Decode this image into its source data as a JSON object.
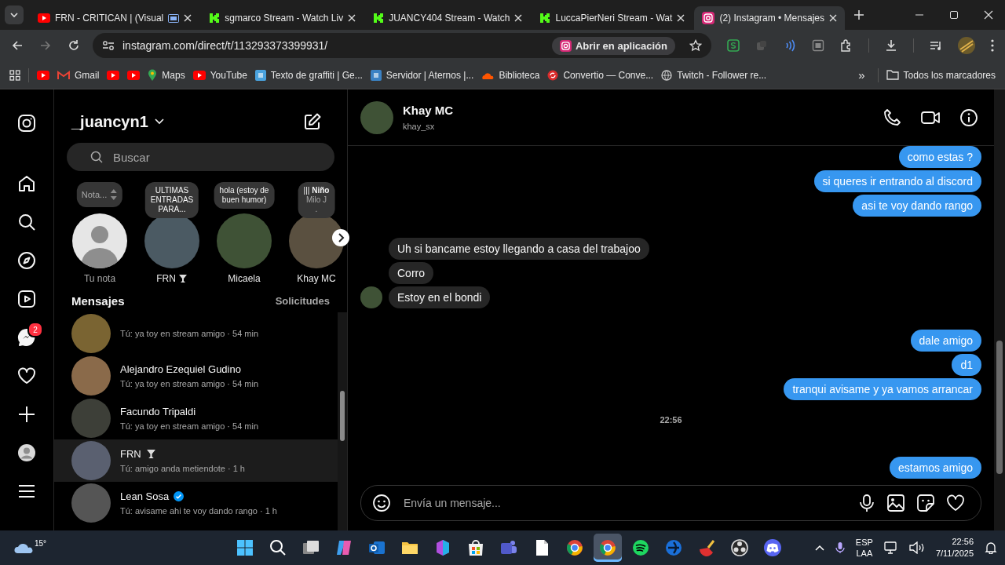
{
  "browser": {
    "tabs": [
      {
        "title": "FRN - CRITICAN | (Visual",
        "kind": "youtube",
        "casting": true,
        "selected": false
      },
      {
        "title": "sgmarco Stream - Watch Liv",
        "kind": "kick",
        "casting": false,
        "selected": false
      },
      {
        "title": "JUANCY404 Stream - Watch",
        "kind": "kick",
        "casting": false,
        "selected": false
      },
      {
        "title": "LuccaPierNeri Stream - Wat",
        "kind": "kick",
        "casting": false,
        "selected": false
      },
      {
        "title": "(2) Instagram • Mensajes",
        "kind": "instagram",
        "casting": false,
        "selected": true
      }
    ],
    "url": "instagram.com/direct/t/113293373399931/",
    "open_app": "Abrir en aplicación",
    "bookmarks": [
      {
        "kind": "youtube"
      },
      {
        "kind": "gmail",
        "label": "Gmail"
      },
      {
        "kind": "youtube"
      },
      {
        "kind": "youtube"
      },
      {
        "kind": "maps",
        "label": "Maps"
      },
      {
        "kind": "youtube",
        "label": "YouTube"
      },
      {
        "kind": "graffiti",
        "label": "Texto de graffiti | Ge..."
      },
      {
        "kind": "aternos",
        "label": "Servidor | Aternos |..."
      },
      {
        "kind": "cloud",
        "label": "Biblioteca"
      },
      {
        "kind": "convertio",
        "label": "Convertio — Conve..."
      },
      {
        "kind": "globe",
        "label": "Twitch - Follower re..."
      }
    ],
    "more_bookmarks": "»",
    "all_bookmarks": "Todos los marcadores"
  },
  "instagram": {
    "rail": [
      {
        "kind": "logo"
      },
      {
        "kind": "home"
      },
      {
        "kind": "search"
      },
      {
        "kind": "explore"
      },
      {
        "kind": "reels"
      },
      {
        "kind": "messages",
        "badge": "2"
      },
      {
        "kind": "notifications"
      },
      {
        "kind": "create"
      },
      {
        "kind": "profile"
      },
      {
        "kind": "more"
      }
    ],
    "account": "_juancyn1",
    "search": {
      "placeholder": "Buscar"
    },
    "notes": [
      {
        "kind": "self",
        "bubble": [
          "Nota..."
        ],
        "name": "Tu nota",
        "trophy": false
      },
      {
        "kind": "friend",
        "bubble": [
          "ULTIMAS",
          "ENTRADAS",
          "PARA..."
        ],
        "name": "FRN",
        "trophy": true
      },
      {
        "kind": "friend",
        "bubble": [
          "hola (estoy de",
          "buen humor)"
        ],
        "name": "Micaela",
        "trophy": false
      },
      {
        "kind": "music",
        "bubble": [
          "||| **Niño**",
          "Milo J",
          "."
        ],
        "name": "Khay MC",
        "trophy": false
      }
    ],
    "messages_title": "Mensajes",
    "requests": "Solicitudes",
    "conversations": [
      {
        "preview": "Tú: ya toy en stream amigo · 54 min",
        "trophy": false,
        "verified": false,
        "selected": false
      },
      {
        "name": "Alejandro Ezequiel Gudino",
        "preview": "Tú: ya toy en stream amigo · 54 min",
        "trophy": false,
        "verified": false,
        "selected": false
      },
      {
        "name": "Facundo Tripaldi",
        "preview": "Tú: ya toy en stream amigo · 54 min",
        "trophy": false,
        "verified": false,
        "selected": false
      },
      {
        "name": "FRN",
        "preview": "Tú: amigo anda metiendote · 1 h",
        "trophy": true,
        "verified": false,
        "selected": true
      },
      {
        "name": "Lean Sosa",
        "preview": "Tú: avisame ahi te voy dando rango · 1 h",
        "trophy": false,
        "verified": true,
        "selected": false
      }
    ],
    "chat": {
      "name": "Khay MC",
      "username": "khay_sx",
      "messages": [
        {
          "kind": "sent",
          "text": "como estas ?"
        },
        {
          "kind": "sent",
          "text": "si queres ir entrando al discord"
        },
        {
          "kind": "sent",
          "text": "asi te voy dando rango"
        },
        {
          "kind": "received",
          "text": "Uh si bancame estoy llegando a casa del trabajoo",
          "avatar": false
        },
        {
          "kind": "received",
          "text": "Corro",
          "avatar": false
        },
        {
          "kind": "received",
          "text": "Estoy en el bondi",
          "avatar": true
        },
        {
          "kind": "sent",
          "text": "dale amigo"
        },
        {
          "kind": "sent",
          "text": "d1"
        },
        {
          "kind": "sent",
          "text": "tranqui avisame y ya vamos arrancar"
        },
        {
          "kind": "time",
          "text": "22:56"
        },
        {
          "kind": "sent",
          "text": "estamos amigo"
        }
      ],
      "composer": {
        "placeholder": "Envía un mensaje..."
      }
    }
  },
  "taskbar": {
    "weather": "15°",
    "apps": [
      {
        "kind": "start",
        "selected": false
      },
      {
        "kind": "search",
        "selected": false
      },
      {
        "kind": "taskview",
        "selected": false
      },
      {
        "kind": "copilot",
        "selected": false
      },
      {
        "kind": "mail",
        "selected": false
      },
      {
        "kind": "folder",
        "selected": false
      },
      {
        "kind": "office",
        "selected": false
      },
      {
        "kind": "store",
        "selected": false
      },
      {
        "kind": "teams",
        "selected": false
      },
      {
        "kind": "file",
        "selected": false
      },
      {
        "kind": "browser",
        "selected": false
      },
      {
        "kind": "browser",
        "selected": true
      },
      {
        "kind": "music",
        "selected": false
      },
      {
        "kind": "bluecircle",
        "selected": false
      },
      {
        "kind": "cleaner",
        "selected": false
      },
      {
        "kind": "recorder",
        "selected": false
      },
      {
        "kind": "chat",
        "selected": false
      }
    ],
    "lang": [
      "ESP",
      "LAA"
    ],
    "time": "22:56",
    "date": "7/11/2025"
  }
}
